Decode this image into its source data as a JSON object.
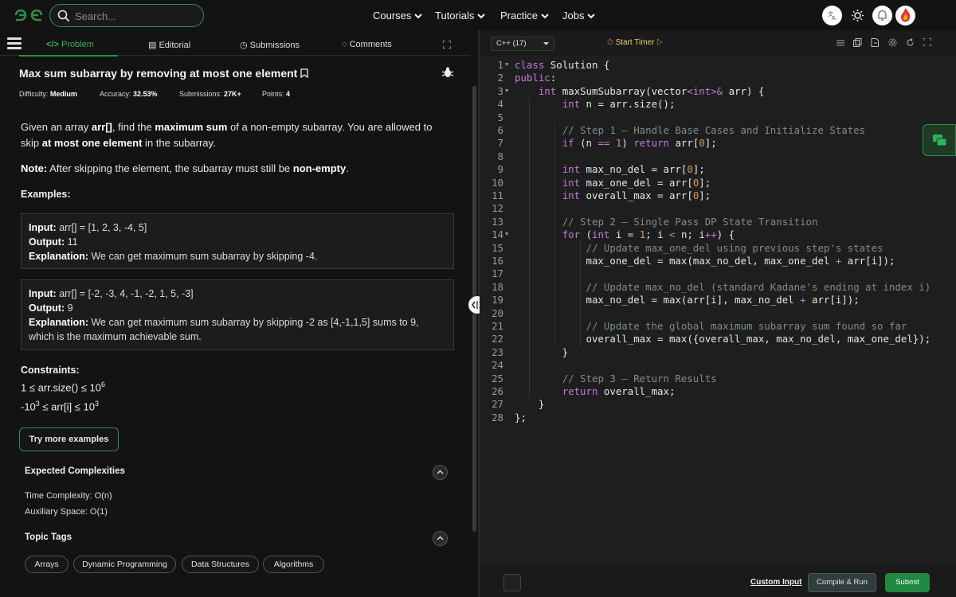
{
  "search": {
    "placeholder": "Search..."
  },
  "nav": [
    "Courses",
    "Tutorials",
    "Practice",
    "Jobs"
  ],
  "tabs": {
    "problem": "Problem",
    "editorial": "Editorial",
    "submissions": "Submissions",
    "comments": "Comments"
  },
  "problem": {
    "title": "Max sum subarray by removing at most one element",
    "difficulty_label": "Difficulty:",
    "difficulty": "Medium",
    "accuracy_label": "Accuracy:",
    "accuracy": "32.53%",
    "submissions_label": "Submissions:",
    "submissions": "27K+",
    "points_label": "Points:",
    "points": "4",
    "desc1_a": "Given an array ",
    "desc1_b": "arr[]",
    "desc1_c": ", find the ",
    "desc1_d": "maximum sum",
    "desc1_e": " of a non-empty subarray. You are allowed to skip ",
    "desc1_f": "at most one element",
    "desc1_g": " in the subarray.",
    "note_label": "Note:",
    "note_text": " After skipping the element, the subarray must still be ",
    "note_bold": "non-empty",
    "note_end": ".",
    "examples_title": "Examples:",
    "examples": [
      {
        "input_label": "Input:",
        "input": " arr[] = [1, 2, 3, -4, 5]",
        "output_label": "Output:",
        "output": " 11",
        "expl_label": "Explanation:",
        "expl": " We can get maximum sum subarray by skipping -4."
      },
      {
        "input_label": "Input:",
        "input": " arr[] = [-2, -3, 4, -1, -2, 1, 5, -3]",
        "output_label": "Output:",
        "output": " 9",
        "expl_label": "Explanation:",
        "expl": " We can get maximum sum subarray by skipping -2 as [4,-1,1,5] sums to 9, which is the maximum achievable sum."
      }
    ],
    "constraints_title": "Constraints:",
    "c1_a": "1 ≤ arr.size() ≤ 10",
    "c1_sup": "6",
    "c2_a": "-10",
    "c2_sup1": "3",
    "c2_b": " ≤ arr[i] ≤ 10",
    "c2_sup2": "3",
    "try_more": "Try more examples",
    "complexities_title": "Expected Complexities",
    "time": "Time Complexity: O(n)",
    "space": "Auxiliary Space: O(1)",
    "topic_title": "Topic Tags",
    "tags": [
      "Arrays",
      "Dynamic Programming",
      "Data Structures",
      "Algorithms"
    ]
  },
  "editor": {
    "language": "C++ (17)",
    "timer": "Start Timer",
    "line_numbers": [
      "1",
      "2",
      "3",
      "4",
      "5",
      "6",
      "7",
      "8",
      "9",
      "10",
      "11",
      "12",
      "13",
      "14",
      "15",
      "16",
      "17",
      "18",
      "19",
      "20",
      "21",
      "22",
      "23",
      "24",
      "25",
      "26",
      "27",
      "28"
    ],
    "lines": [
      "class Solution {",
      "public:",
      "    int maxSumSubarray(vector<int>& arr) {",
      "        int n = arr.size();",
      "",
      "        // Step 1 — Handle Base Cases and Initialize States",
      "        if (n == 1) return arr[0];",
      "",
      "        int max_no_del = arr[0];",
      "        int max_one_del = arr[0];",
      "        int overall_max = arr[0];",
      "",
      "        // Step 2 — Single Pass DP State Transition",
      "        for (int i = 1; i < n; i++) {",
      "            // Update max_one_del using previous step's states",
      "            max_one_del = max(max_no_del, max_one_del + arr[i]);",
      "",
      "            // Update max_no_del (standard Kadane's ending at index i)",
      "            max_no_del = max(arr[i], max_no_del + arr[i]);",
      "",
      "            // Update the global maximum subarray sum found so far",
      "            overall_max = max({overall_max, max_no_del, max_one_del});",
      "        }",
      "",
      "        // Step 3 — Return Results",
      "        return overall_max;",
      "    }",
      "};"
    ],
    "custom_input": "Custom Input",
    "compile": "Compile & Run",
    "submit": "Submit"
  }
}
